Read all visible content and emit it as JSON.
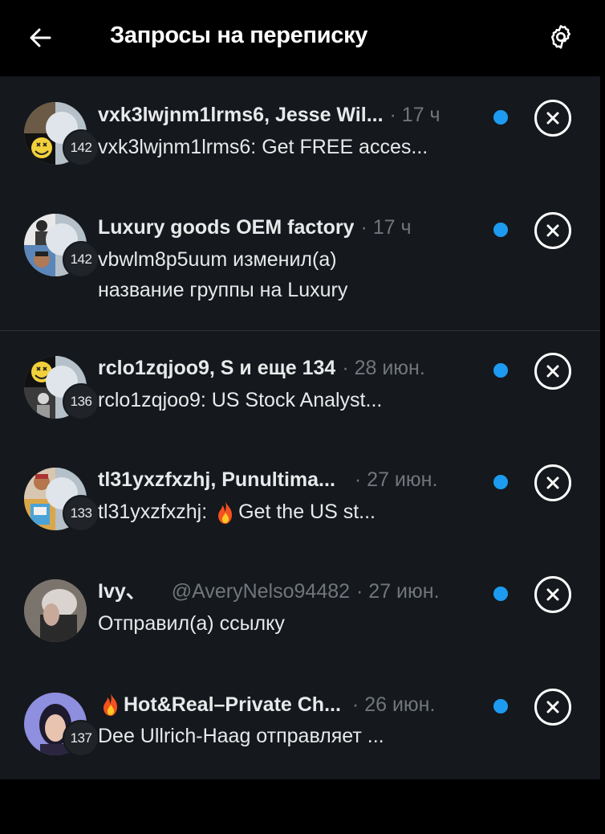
{
  "header": {
    "title": "Запросы на переписку",
    "back_icon": "arrow-left-icon",
    "settings_icon": "gear-icon"
  },
  "accent_color": "#1d9bf0",
  "requests": [
    {
      "name": "vxk3lwjnm1lrms6, Jesse Wil...",
      "time": "· 17 ч",
      "preview": "vxk3lwjnm1lrms6: Get FREE acces...",
      "count": "142",
      "unread": true
    },
    {
      "name": "Luxury goods OEM factory",
      "time": "· 17 ч",
      "preview_line1": "vbwlm8p5uum изменил(а)",
      "preview_line2": "название группы на Luxury",
      "count": "142",
      "unread": true
    },
    {
      "name": "rclo1zqjoo9, S и еще 134",
      "time": "· 28 июн.",
      "preview": "rclo1zqjoo9: US Stock Analyst...",
      "count": "136",
      "unread": true
    },
    {
      "name": "tl31yxzfxzhj, Punultima...",
      "time": "· 27 июн.",
      "preview_prefix": "tl31yxzfxzhj: ",
      "preview_suffix": "Get the US st...",
      "count": "133",
      "unread": true
    },
    {
      "name": "Ivy、",
      "handle": "@AveryNelso94482",
      "time": "· 27 июн.",
      "preview": "Отправил(а) ссылку",
      "unread": true
    },
    {
      "name": "Hot&Real–Private Ch...",
      "time": "· 26 июн.",
      "preview": "Dee Ullrich-Haag отправляет ...",
      "count": "137",
      "unread": true
    }
  ]
}
